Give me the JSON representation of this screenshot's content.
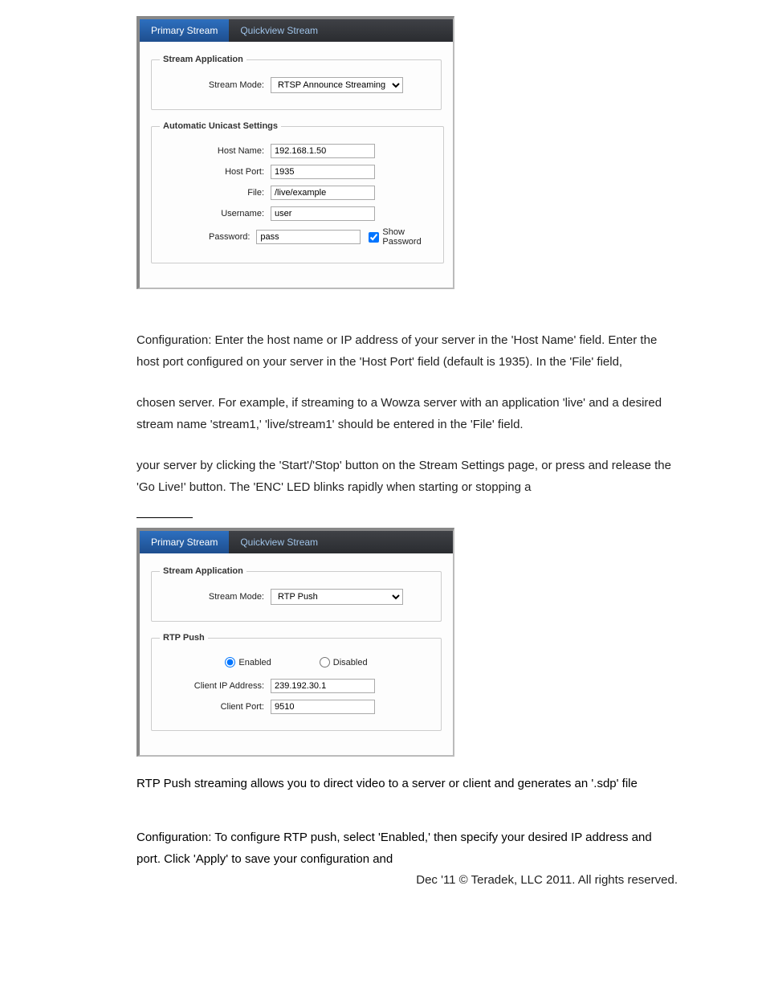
{
  "panel1": {
    "tabs": {
      "primary": "Primary Stream",
      "quickview": "Quickview Stream"
    },
    "stream_app": {
      "legend": "Stream Application",
      "mode_label": "Stream Mode:",
      "mode_value": "RTSP Announce Streaming"
    },
    "unicast": {
      "legend": "Automatic Unicast Settings",
      "host_name_label": "Host Name:",
      "host_name_value": "192.168.1.50",
      "host_port_label": "Host Port:",
      "host_port_value": "1935",
      "file_label": "File:",
      "file_value": "/live/example",
      "username_label": "Username:",
      "username_value": "user",
      "password_label": "Password:",
      "password_value": "pass",
      "show_pw": "Show Password"
    }
  },
  "text_block_1": {
    "p1": "Configuration: Enter the host name or IP address of your server in the 'Host Name' field. Enter the host port configured on your server in the 'Host Port' field (default is 1935). In the 'File' field,",
    "p2": "chosen server. For example, if streaming to a Wowza server with an application 'live' and a desired stream name 'stream1,' 'live/stream1' should be entered in the 'File' field.",
    "p3": "your server by clicking the 'Start'/'Stop' button on the Stream Settings page, or press and release the 'Go Live!' button. The 'ENC' LED blinks rapidly when starting or stopping a"
  },
  "panel2": {
    "tabs": {
      "primary": "Primary Stream",
      "quickview": "Quickview Stream"
    },
    "stream_app": {
      "legend": "Stream Application",
      "mode_label": "Stream Mode:",
      "mode_value": "RTP Push"
    },
    "rtp": {
      "legend": "RTP Push",
      "enabled": "Enabled",
      "disabled": "Disabled",
      "client_ip_label": "Client IP Address:",
      "client_ip_value": "239.192.30.1",
      "client_port_label": "Client Port:",
      "client_port_value": "9510"
    }
  },
  "text_block_2": {
    "p1": "RTP Push streaming allows you to direct video to a server or client and generates an '.sdp' file",
    "p2": "Configuration: To configure RTP push, select 'Enabled,' then specify your desired IP address and port. Click 'Apply' to save your configuration and"
  },
  "footer": "Dec '11 © Teradek, LLC 2011. All rights reserved."
}
